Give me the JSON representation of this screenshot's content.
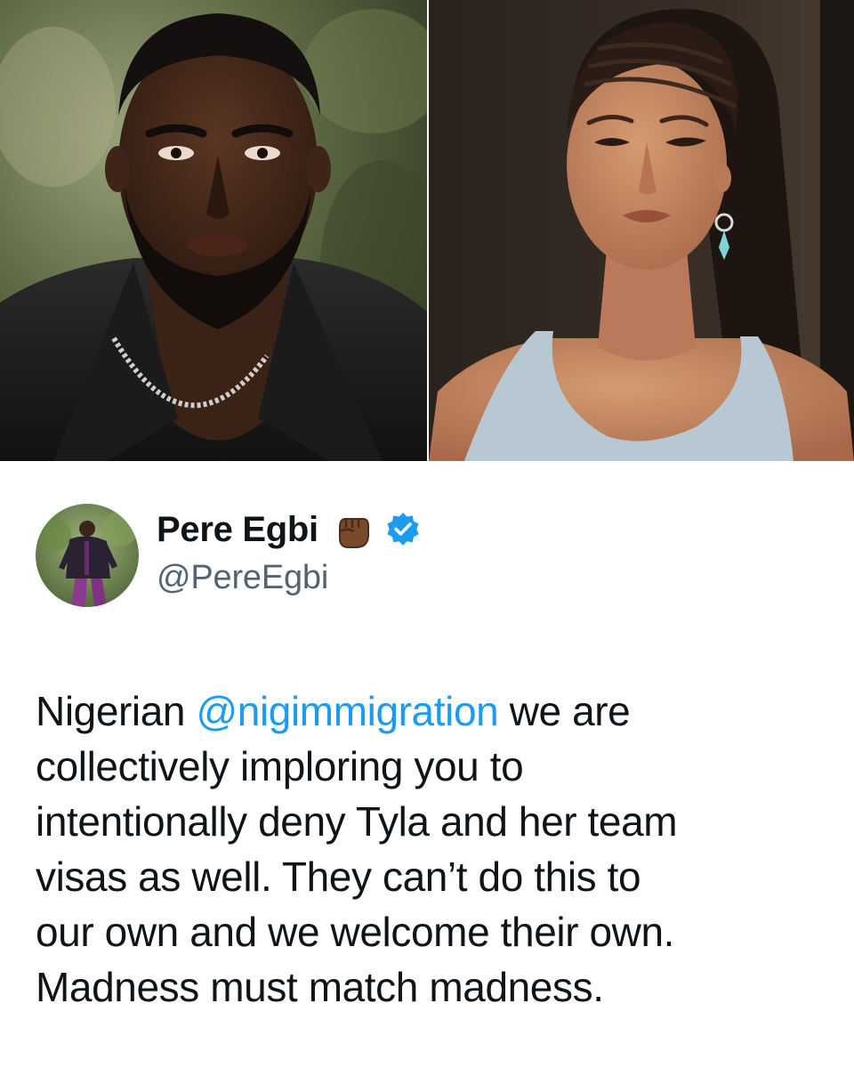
{
  "tweet": {
    "display_name": "Pere Egbi",
    "handle": "@PereEgbi",
    "verified": true,
    "name_emoji": "raised-fist-medium-dark-icon",
    "body_lines": [
      {
        "before": "Nigerian ",
        "mention": "@nigimmigration",
        "after": " we are"
      },
      {
        "text": "collectively imploring you to"
      },
      {
        "text": "intentionally deny Tyla and her team"
      },
      {
        "text": "visas as well.  They can’t do this to"
      },
      {
        "text": "our own and we welcome their own."
      },
      {
        "text": "Madness must match madness."
      }
    ]
  },
  "photos": {
    "left": "portrait-photo-man",
    "right": "portrait-photo-woman"
  },
  "colors": {
    "mention": "#1d9bf0",
    "verified_badge": "#1d9bf0",
    "handle": "#536471",
    "text": "#0f1419"
  }
}
